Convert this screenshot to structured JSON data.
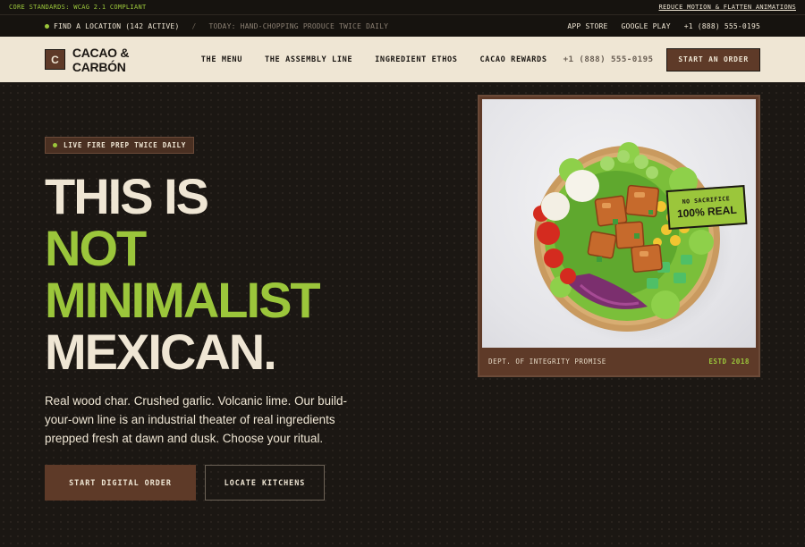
{
  "compliance_bar": {
    "left_text": "CORE STANDARDS: WCAG 2.1 COMPLIANT",
    "right_link": "REDUCE MOTION & FLATTEN ANIMATIONS"
  },
  "utility_bar": {
    "location_link": "FIND A LOCATION (142 ACTIVE)",
    "separator": "/",
    "today_text": "TODAY: HAND-CHOPPING PRODUCE TWICE DAILY",
    "app_store": "APP STORE",
    "google_play": "GOOGLE PLAY",
    "phone": "+1 (888) 555-0195"
  },
  "nav": {
    "logo_mark": "C",
    "logo_text": "CACAO & CARBÓN",
    "items": [
      {
        "label": "THE MENU"
      },
      {
        "label": "THE ASSEMBLY LINE"
      },
      {
        "label": "INGREDIENT ETHOS"
      },
      {
        "label": "CACAO REWARDS"
      }
    ],
    "phone": "+1 (888) 555-0195",
    "cta": "START AN ORDER"
  },
  "hero": {
    "badge": "LIVE FIRE PREP TWICE DAILY",
    "headline": [
      "THIS IS",
      "NOT",
      "MINIMALIST",
      "MEXICAN."
    ],
    "description": "Real wood char. Crushed garlic. Volcanic lime. Our build-your-own line is an industrial theater of real ingredients prepped fresh at dawn and dusk. Choose your ritual.",
    "primary_button": "START DIGITAL ORDER",
    "secondary_button": "LOCATE KITCHENS"
  },
  "card": {
    "footer_left": "DEPT. OF INTEGRITY PROMISE",
    "footer_right": "ESTD 2018",
    "sticker_line1": "NO SACRIFICE",
    "sticker_line2": "100% REAL",
    "image_subject": "salad-bowl"
  },
  "colors": {
    "background": "#1b1713",
    "cream": "#efe6d4",
    "accent_green": "#9bc63b",
    "brown": "#5e3a28"
  }
}
